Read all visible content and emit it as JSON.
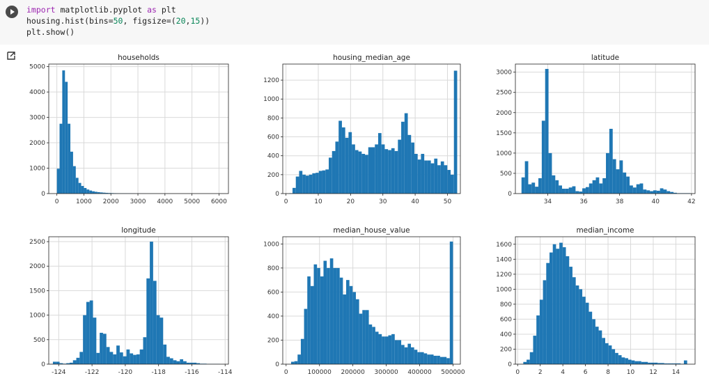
{
  "code": {
    "line1": {
      "kw1": "import",
      "mid": " matplotlib.pyplot ",
      "kw2": "as",
      "end": " plt"
    },
    "line2": {
      "pre": "housing.hist(bins=",
      "n1": "50",
      "mid": ", figsize=(",
      "n2": "20",
      "comma": ",",
      "n3": "15",
      "end": "))"
    },
    "line3": "plt.show()"
  },
  "colors": {
    "bar": "#1f77b4",
    "grid": "#d9d9d9",
    "axis": "#222222"
  },
  "chart_data": [
    {
      "type": "bar",
      "title": "households",
      "grid": true,
      "xlim": [
        -300,
        6350
      ],
      "ylim": [
        0,
        5100
      ],
      "xticks": [
        0,
        1000,
        2000,
        3000,
        4000,
        5000,
        6000
      ],
      "yticks": [
        0,
        1000,
        2000,
        3000,
        4000,
        5000
      ],
      "bin_start": 0,
      "bin_width": 100,
      "values": [
        980,
        2750,
        4850,
        4400,
        2750,
        1650,
        1080,
        620,
        420,
        300,
        220,
        160,
        120,
        90,
        70,
        55,
        45,
        35,
        28,
        22,
        18,
        15,
        12,
        10,
        9,
        8,
        7,
        6,
        5,
        4,
        3,
        3,
        3,
        2,
        2,
        2,
        2,
        1,
        1,
        1,
        1,
        1,
        1,
        1,
        1,
        1,
        1,
        1,
        1,
        1
      ]
    },
    {
      "type": "bar",
      "title": "housing_median_age",
      "grid": true,
      "xlim": [
        -1,
        54
      ],
      "ylim": [
        0,
        1370
      ],
      "xticks": [
        0,
        10,
        20,
        30,
        40,
        50
      ],
      "yticks": [
        0,
        200,
        400,
        600,
        800,
        1000,
        1200
      ],
      "bin_start": 1,
      "bin_width": 1.02,
      "values": [
        4,
        60,
        180,
        240,
        200,
        190,
        200,
        215,
        220,
        240,
        245,
        255,
        380,
        450,
        550,
        770,
        700,
        590,
        650,
        520,
        460,
        445,
        420,
        410,
        490,
        490,
        520,
        640,
        520,
        470,
        460,
        480,
        450,
        570,
        760,
        850,
        620,
        540,
        420,
        360,
        420,
        350,
        350,
        320,
        370,
        300,
        340,
        300,
        250,
        200,
        1300
      ]
    },
    {
      "type": "bar",
      "title": "latitude",
      "grid": true,
      "xlim": [
        32.2,
        42.2
      ],
      "ylim": [
        0,
        3200
      ],
      "xticks": [
        34,
        36,
        38,
        40,
        42
      ],
      "yticks": [
        0,
        500,
        1000,
        1500,
        2000,
        2500,
        3000
      ],
      "bin_start": 32.54,
      "bin_width": 0.188,
      "values": [
        400,
        800,
        230,
        270,
        170,
        380,
        1800,
        3080,
        1000,
        450,
        330,
        200,
        120,
        120,
        150,
        180,
        60,
        50,
        130,
        160,
        250,
        330,
        400,
        250,
        380,
        1000,
        1600,
        850,
        600,
        820,
        520,
        420,
        200,
        150,
        230,
        250,
        100,
        80,
        60,
        80,
        70,
        130,
        100,
        60,
        40,
        20,
        10,
        10,
        10,
        10
      ]
    },
    {
      "type": "bar",
      "title": "longitude",
      "grid": true,
      "xlim": [
        -124.6,
        -113.8
      ],
      "ylim": [
        0,
        2600
      ],
      "xticks": [
        -124,
        -122,
        -120,
        -118,
        -116,
        -114
      ],
      "yticks": [
        0,
        500,
        1000,
        1500,
        2000,
        2500
      ],
      "bin_start": -124.35,
      "bin_width": 0.2008,
      "values": [
        50,
        50,
        20,
        10,
        20,
        30,
        80,
        130,
        250,
        1000,
        1270,
        1300,
        950,
        230,
        640,
        620,
        350,
        250,
        200,
        380,
        240,
        160,
        300,
        220,
        190,
        200,
        300,
        550,
        1750,
        2500,
        1700,
        1000,
        950,
        400,
        150,
        120,
        80,
        60,
        100,
        60,
        30,
        30,
        30,
        20,
        10,
        10,
        5,
        5,
        5,
        5
      ]
    },
    {
      "type": "bar",
      "title": "median_house_value",
      "grid": true,
      "xlim": [
        -10000,
        522000
      ],
      "ylim": [
        0,
        1060
      ],
      "xticks": [
        0,
        100000,
        200000,
        300000,
        400000,
        500000
      ],
      "yticks": [
        0,
        200,
        400,
        600,
        800,
        1000
      ],
      "bin_start": 15000,
      "bin_width": 9700,
      "values": [
        20,
        25,
        80,
        210,
        460,
        730,
        650,
        830,
        800,
        730,
        860,
        800,
        880,
        800,
        800,
        720,
        580,
        700,
        650,
        600,
        540,
        420,
        450,
        450,
        330,
        310,
        270,
        250,
        230,
        230,
        240,
        250,
        200,
        200,
        160,
        140,
        170,
        140,
        120,
        100,
        100,
        90,
        80,
        80,
        70,
        70,
        60,
        60,
        50,
        1020
      ]
    },
    {
      "type": "bar",
      "title": "median_income",
      "grid": true,
      "xlim": [
        -0.2,
        15.7
      ],
      "ylim": [
        0,
        1700
      ],
      "xticks": [
        0,
        2,
        4,
        6,
        8,
        10,
        12,
        14
      ],
      "yticks": [
        0,
        200,
        400,
        600,
        800,
        1000,
        1200,
        1400,
        1600
      ],
      "bin_start": 0.5,
      "bin_width": 0.29,
      "values": [
        30,
        60,
        160,
        380,
        650,
        860,
        1120,
        1350,
        1490,
        1600,
        1540,
        1620,
        1560,
        1440,
        1300,
        1160,
        1050,
        1000,
        900,
        820,
        700,
        600,
        500,
        450,
        350,
        280,
        250,
        200,
        150,
        120,
        90,
        80,
        60,
        50,
        40,
        40,
        30,
        30,
        20,
        20,
        20,
        15,
        15,
        10,
        10,
        10,
        10,
        10,
        5,
        50
      ]
    }
  ]
}
